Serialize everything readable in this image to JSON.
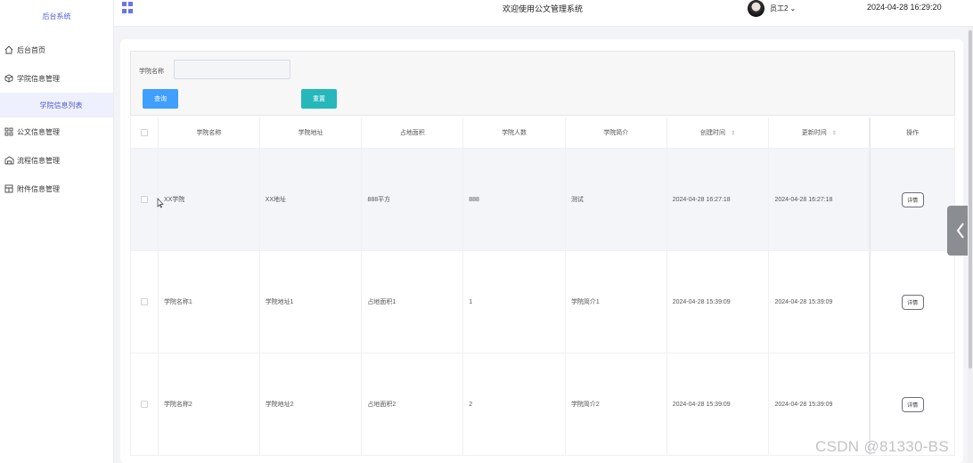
{
  "sidebar": {
    "brand": "后台系统",
    "items": [
      {
        "label": "后台首页",
        "icon": "home-icon"
      },
      {
        "label": "学院信息管理",
        "icon": "cube-icon"
      },
      {
        "label": "学院信息列表",
        "icon": ""
      },
      {
        "label": "公文信息管理",
        "icon": "grid-icon"
      },
      {
        "label": "流程信息管理",
        "icon": "building-icon"
      },
      {
        "label": "附件信息管理",
        "icon": "layout-icon"
      }
    ]
  },
  "header": {
    "title": "欢迎使用公文管理系统",
    "user": "员工2",
    "datetime": "2024-04-28 16:29:20"
  },
  "search": {
    "label": "学院名称",
    "value": "",
    "query_label": "查询",
    "reset_label": "重置"
  },
  "table": {
    "columns": [
      "学院名称",
      "学院地址",
      "占地面积",
      "学院人数",
      "学院简介",
      "创建时间",
      "更新时间",
      "操作"
    ],
    "rows": [
      {
        "name": "XX学院",
        "address": "XX地址",
        "area": "888平方",
        "count": "888",
        "intro": "测试",
        "created": "2024-04-28 16:27:18",
        "updated": "2024-04-28 16:27:18",
        "action": "详情"
      },
      {
        "name": "学院名称1",
        "address": "学院地址1",
        "area": "占地面积1",
        "count": "1",
        "intro": "学院简介1",
        "created": "2024-04-28 15:39:09",
        "updated": "2024-04-28 15:39:09",
        "action": "详情"
      },
      {
        "name": "学院名称2",
        "address": "学院地址2",
        "area": "占地面积2",
        "count": "2",
        "intro": "学院简介2",
        "created": "2024-04-28 15:39:09",
        "updated": "2024-04-28 15:39:09",
        "action": "详情"
      }
    ]
  },
  "watermark": "CSDN @81330-BS"
}
